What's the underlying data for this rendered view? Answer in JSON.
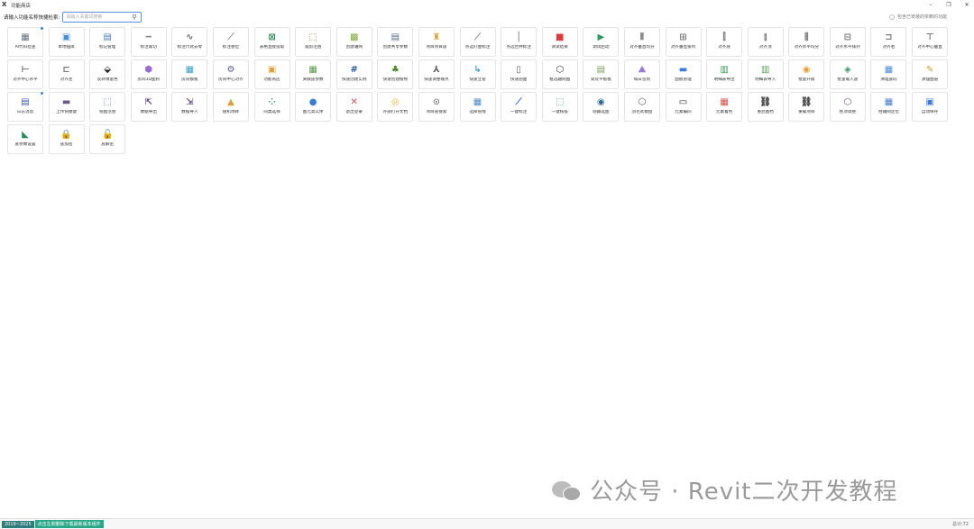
{
  "window": {
    "title": "功能商店",
    "logo": "X",
    "minimize_glyph": "–",
    "maximize_glyph": "❐",
    "close_glyph": "✕"
  },
  "search": {
    "label": "请输入功能名称快捷检索:",
    "placeholder": "请输入关键词搜索",
    "icon": "search-icon"
  },
  "include_toggle": {
    "label": "包含已安装的依赖的功能"
  },
  "tiles": [
    {
      "label": "AI代码检查",
      "glyph": "▦",
      "color": "#6a6f86",
      "icon": "ai-code-icon",
      "dot": true
    },
    {
      "label": "本地插库",
      "glyph": "▣",
      "color": "#3f8dd9",
      "icon": "local-library-icon"
    },
    {
      "label": "标记管理",
      "glyph": "▤",
      "color": "#4a7fc0",
      "icon": "tag-manage-icon"
    },
    {
      "label": "标注裁切",
      "glyph": "━",
      "color": "#8a8a8a",
      "icon": "dimension-trim-icon"
    },
    {
      "label": "标注尺式去零",
      "glyph": "∿",
      "color": "#666666",
      "icon": "dimension-zero-icon"
    },
    {
      "label": "标注替位",
      "glyph": "⟋",
      "color": "#8a8ab0",
      "icon": "dimension-replace-icon"
    },
    {
      "label": "表格直接提取",
      "glyph": "⊠",
      "color": "#2e8b57",
      "icon": "table-extract-icon"
    },
    {
      "label": "裁剪范围",
      "glyph": "⬚",
      "color": "#b07850",
      "icon": "crop-range-icon"
    },
    {
      "label": "创建轴网",
      "glyph": "▩",
      "color": "#7fa83a",
      "icon": "create-grid-icon"
    },
    {
      "label": "创建共享参数",
      "glyph": "▤",
      "color": "#5a6a8a",
      "icon": "shared-param-icon"
    },
    {
      "label": "项目项目族",
      "glyph": "♜",
      "color": "#d9a23a",
      "icon": "project-family-icon"
    },
    {
      "label": "点选钉图标注",
      "glyph": "⟋",
      "color": "#8a8a9a",
      "icon": "pick-tag-icon"
    },
    {
      "label": "点选合并标注",
      "glyph": "│",
      "color": "#6a6a6a",
      "icon": "merge-tag-icon"
    },
    {
      "label": "调试结果",
      "glyph": "■",
      "color": "#e03a3a",
      "icon": "debug-result-icon"
    },
    {
      "label": "调试启动",
      "glyph": "▶",
      "color": "#2e9a5a",
      "icon": "debug-start-icon"
    },
    {
      "label": "对齐垂直均分",
      "glyph": "⫴",
      "color": "#777777",
      "icon": "align-vertical-distribute-icon"
    },
    {
      "label": "对齐垂直排列",
      "glyph": "⊞",
      "color": "#777777",
      "icon": "align-vertical-arrange-icon"
    },
    {
      "label": "对齐底",
      "glyph": "⫿",
      "color": "#777777",
      "icon": "align-bottom-icon"
    },
    {
      "label": "对齐顶",
      "glyph": "⫾",
      "color": "#777777",
      "icon": "align-top-icon"
    },
    {
      "label": "对齐水平均分",
      "glyph": "⫼",
      "color": "#777777",
      "icon": "align-horizontal-distribute-icon"
    },
    {
      "label": "对齐水平排列",
      "glyph": "⊟",
      "color": "#777777",
      "icon": "align-horizontal-arrange-icon"
    },
    {
      "label": "对齐右",
      "glyph": "⊐",
      "color": "#777777",
      "icon": "align-right-icon"
    },
    {
      "label": "对齐中心垂直",
      "glyph": "⊤",
      "color": "#777777",
      "icon": "align-center-vertical-icon"
    },
    {
      "label": "对齐中心水平",
      "glyph": "⊢",
      "color": "#777777",
      "icon": "align-center-horizontal-icon"
    },
    {
      "label": "对齐左",
      "glyph": "⊏",
      "color": "#777777",
      "icon": "align-left-icon"
    },
    {
      "label": "反转填量色",
      "glyph": "⬙",
      "color": "#222222",
      "icon": "invert-fill-icon"
    },
    {
      "label": "房间3D面积",
      "glyph": "⬢",
      "color": "#9a6ad9",
      "icon": "room-3d-icon"
    },
    {
      "label": "房间模板",
      "glyph": "▦",
      "color": "#3aa0c8",
      "icon": "room-template-icon"
    },
    {
      "label": "房间中心对齐",
      "glyph": "⚙",
      "color": "#5a5a8a",
      "icon": "room-center-icon"
    },
    {
      "label": "功能商店",
      "glyph": "▣",
      "color": "#e0a03a",
      "icon": "store-icon"
    },
    {
      "label": "关联族参数",
      "glyph": "▦",
      "color": "#5a9a4a",
      "icon": "family-param-icon"
    },
    {
      "label": "快速创建实例",
      "glyph": "#",
      "color": "#2a5aa0",
      "icon": "quick-instance-icon"
    },
    {
      "label": "快速创建植物",
      "glyph": "♣",
      "color": "#4a8a2a",
      "icon": "quick-plant-icon"
    },
    {
      "label": "快速调整端点",
      "glyph": "⅄",
      "color": "#666666",
      "icon": "adjust-endpoint-icon"
    },
    {
      "label": "快速立管",
      "glyph": "↳",
      "color": "#3a9ac8",
      "icon": "quick-riser-icon"
    },
    {
      "label": "快速剖面",
      "glyph": "▯",
      "color": "#666666",
      "icon": "quick-section-icon"
    },
    {
      "label": "框选轴网图",
      "glyph": "⬡",
      "color": "#333333",
      "icon": "box-select-grid-icon"
    },
    {
      "label": "梁及平板板",
      "glyph": "▤",
      "color": "#7a9a5a",
      "icon": "beam-slab-icon"
    },
    {
      "label": "每日签到",
      "glyph": "⛰",
      "color": "#9a7ad9",
      "icon": "daily-checkin-icon"
    },
    {
      "label": "面板管理",
      "glyph": "▬",
      "color": "#3a7ad9",
      "icon": "panel-manage-icon"
    },
    {
      "label": "明细表导出",
      "glyph": "▥",
      "color": "#3a9a5a",
      "icon": "schedule-export-icon"
    },
    {
      "label": "明细表导入",
      "glyph": "▥",
      "color": "#5aa05a",
      "icon": "schedule-import-icon"
    },
    {
      "label": "批量升级",
      "glyph": "◉",
      "color": "#e8a030",
      "icon": "batch-upgrade-icon"
    },
    {
      "label": "批量载入族",
      "glyph": "◈",
      "color": "#3a9a6a",
      "icon": "batch-load-family-icon"
    },
    {
      "label": "清理族码",
      "glyph": "▦",
      "color": "#4a8ad9",
      "icon": "clean-family-icon"
    },
    {
      "label": "清理图层",
      "glyph": "✎",
      "color": "#c8a030",
      "icon": "clean-layer-icon"
    },
    {
      "label": "日志消息",
      "glyph": "▤",
      "color": "#3a5aa0",
      "icon": "log-message-icon",
      "dot": true
    },
    {
      "label": "上传快捷键",
      "glyph": "▬",
      "color": "#6a5a8a",
      "icon": "upload-shortcut-icon"
    },
    {
      "label": "视图范围",
      "glyph": "⬚",
      "color": "#5a7aa0",
      "icon": "view-range-icon"
    },
    {
      "label": "数据导出",
      "glyph": "⇱",
      "color": "#5a4a7a",
      "icon": "data-export-icon"
    },
    {
      "label": "数据导入",
      "glyph": "⇲",
      "color": "#5a4a7a",
      "icon": "data-import-icon"
    },
    {
      "label": "随机地砖",
      "glyph": "▲",
      "color": "#d9a03a",
      "icon": "random-tile-icon"
    },
    {
      "label": "同类选择",
      "glyph": "⁘",
      "color": "#3a9a6a",
      "icon": "select-similar-icon"
    },
    {
      "label": "图元高实体",
      "glyph": "●",
      "color": "#3a7ad9",
      "icon": "element-solid-icon"
    },
    {
      "label": "退出登录",
      "glyph": "✕",
      "color": "#e04a4a",
      "icon": "logout-icon"
    },
    {
      "label": "外部打开文档",
      "glyph": "◎",
      "color": "#e0b030",
      "icon": "open-document-icon"
    },
    {
      "label": "项目族搜索",
      "glyph": "⊙",
      "color": "#888888",
      "icon": "family-search-icon"
    },
    {
      "label": "选择管线",
      "glyph": "▦",
      "color": "#4a8ac8",
      "icon": "select-pipe-icon"
    },
    {
      "label": "一键标注",
      "glyph": "⟋",
      "color": "#2a6ac8",
      "icon": "one-click-tag-icon"
    },
    {
      "label": "一键核核",
      "glyph": "⬚",
      "color": "#6a8aa0",
      "icon": "one-click-check-icon"
    },
    {
      "label": "隐藏选图",
      "glyph": "◉",
      "color": "#2a6a8a",
      "icon": "hide-select-icon"
    },
    {
      "label": "羽毛式模盘",
      "glyph": "⬡",
      "color": "#555555",
      "icon": "feather-mold-icon"
    },
    {
      "label": "元素编码",
      "glyph": "▭",
      "color": "#333333",
      "icon": "element-code-icon"
    },
    {
      "label": "元素着色",
      "glyph": "▦",
      "color": "#d94a3a",
      "icon": "element-color-icon"
    },
    {
      "label": "重启图档",
      "glyph": "⛓",
      "color": "#444444",
      "icon": "restart-doc-icon"
    },
    {
      "label": "重载项目",
      "glyph": "⛓",
      "color": "#444444",
      "icon": "reload-project-icon"
    },
    {
      "label": "柱顶调整",
      "glyph": "⬡",
      "color": "#6a5a8a",
      "icon": "column-top-icon"
    },
    {
      "label": "柱轴网定位",
      "glyph": "▦",
      "color": "#4a7ac8",
      "icon": "column-grid-icon"
    },
    {
      "label": "自动保存",
      "glyph": "▣",
      "color": "#3a7ad9",
      "icon": "auto-save-icon"
    },
    {
      "label": "族参数设置",
      "glyph": "◣",
      "color": "#2a8a5a",
      "icon": "family-param-setting-icon"
    },
    {
      "label": "族加密",
      "glyph": "🔒",
      "color": "#e08a2a",
      "icon": "family-encrypt-icon"
    },
    {
      "label": "族解密",
      "glyph": "🔓",
      "color": "#e08a2a",
      "icon": "family-decrypt-icon"
    }
  ],
  "watermark": {
    "text": "公众号 · Revit二次开发教程"
  },
  "status": {
    "year": "2019~2025",
    "link": "点击左侧删除下载最新版本组件",
    "total": "总计:72"
  }
}
